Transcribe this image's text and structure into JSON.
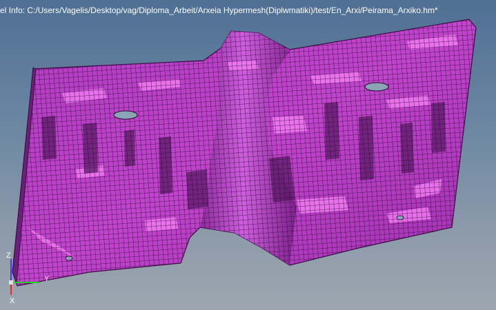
{
  "viewport": {
    "model_info": "el Info: C:/Users/Vagelis/Desktop/vag/Diploma_Arbeit/Arxeia Hypermesh(Diplwmatiki)/test/En_Arxi/Peirama_Arxiko.hm*"
  },
  "mesh": {
    "fill_color": "#c040c8",
    "highlight_color": "#f070f0",
    "shadow_color": "#5a1a66",
    "line_color": "#2a0a30"
  },
  "triad": {
    "z_label": "Z",
    "y_label": "Y",
    "x_label": "X",
    "z_color": "#3a3aff",
    "y_color": "#20d020",
    "x_color": "#ff2020"
  }
}
